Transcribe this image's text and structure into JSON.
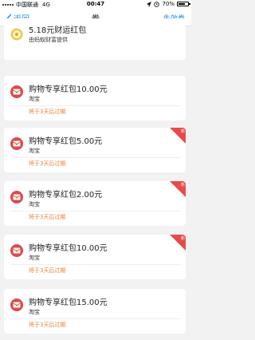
{
  "status": {
    "carrier": "中国联通",
    "network": "4G",
    "time": "00:47",
    "battery": "70%",
    "battery_level": 0.7
  },
  "nav": {
    "back_label": "返回",
    "title": "券",
    "right_label": "失效券"
  },
  "coupons": [
    {
      "title": "5.18元财运红包",
      "source": "由蚂蚁财富提供",
      "expire": "",
      "new_badge": "",
      "icon": "gold-coin-icon"
    },
    {
      "title": "购物专享红包10.00元",
      "source": "淘宝",
      "expire": "将于3天后过期",
      "new_badge": "",
      "icon": "red-envelope-icon"
    },
    {
      "title": "购物专享红包5.00元",
      "source": "淘宝",
      "expire": "将于3天后过期",
      "new_badge": "新",
      "icon": "red-envelope-icon"
    },
    {
      "title": "购物专享红包2.00元",
      "source": "淘宝",
      "expire": "将于3天后过期",
      "new_badge": "新",
      "icon": "red-envelope-icon"
    },
    {
      "title": "购物专享红包10.00元",
      "source": "淘宝",
      "expire": "将于3天后过期",
      "new_badge": "新",
      "icon": "red-envelope-icon"
    },
    {
      "title": "购物专享红包15.00元",
      "source": "淘宝",
      "expire": "将于3天后过期",
      "new_badge": "",
      "icon": "red-envelope-icon"
    }
  ]
}
